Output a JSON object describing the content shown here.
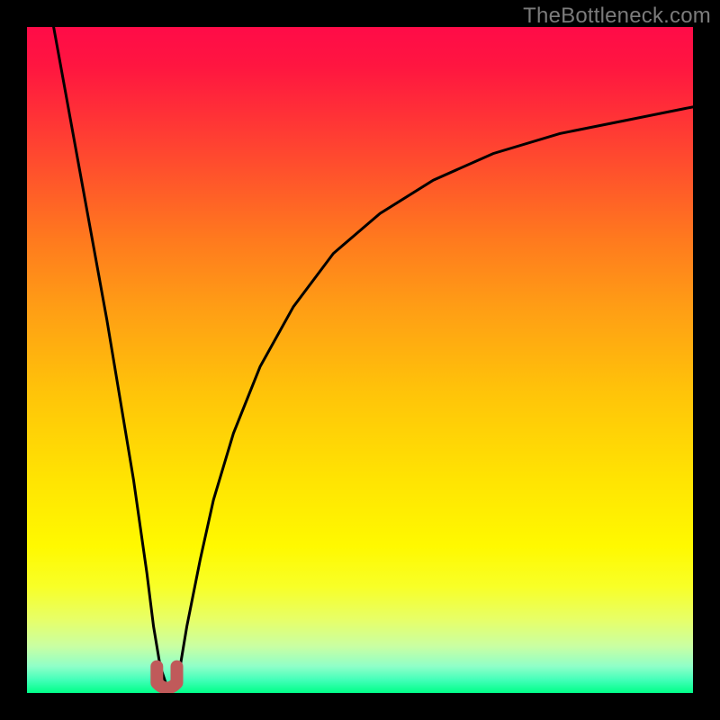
{
  "watermark": "TheBottleneck.com",
  "colors": {
    "frame": "#000000",
    "curve": "#000000",
    "marker": "#c05a5a",
    "gradient_top": "#ff0b48",
    "gradient_bottom": "#00ff88"
  },
  "chart_data": {
    "type": "line",
    "title": "",
    "xlabel": "",
    "ylabel": "",
    "xlim": [
      0,
      100
    ],
    "ylim": [
      0,
      100
    ],
    "grid": false,
    "note": "Axes are unlabeled; x and y expressed as percent of plot width/height. y is bottleneck percentage (0 at bottom / green, 100 at top / red). Curve dips to ~0 near x≈21 then rises toward ~88 at right edge.",
    "series": [
      {
        "name": "bottleneck-curve",
        "x": [
          4,
          6,
          8,
          10,
          12,
          14,
          16,
          18,
          19,
          20,
          21,
          22,
          23,
          24,
          26,
          28,
          31,
          35,
          40,
          46,
          53,
          61,
          70,
          80,
          90,
          100
        ],
        "y": [
          100,
          89,
          78,
          67,
          56,
          44,
          32,
          18,
          10,
          4,
          1,
          1,
          4,
          10,
          20,
          29,
          39,
          49,
          58,
          66,
          72,
          77,
          81,
          84,
          86,
          88
        ]
      }
    ],
    "marker": {
      "name": "optimal-point",
      "shape": "u",
      "x_range": [
        19.5,
        22.5
      ],
      "y": 1
    }
  }
}
